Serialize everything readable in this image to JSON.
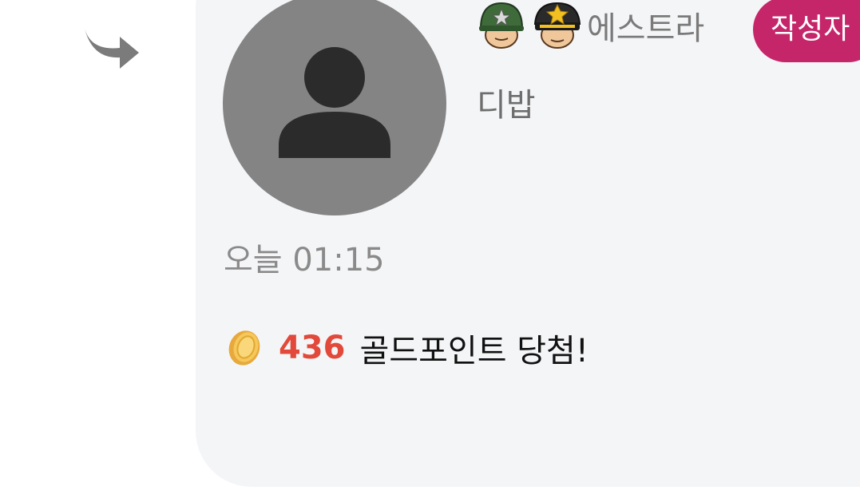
{
  "comment": {
    "nickname": "에스트라",
    "author_badge": "작성자",
    "text": "디밥",
    "timestamp": "오늘 01:15",
    "reward": {
      "points": "436",
      "message": "골드포인트 당첨!"
    },
    "badges": [
      "army-helmet-icon",
      "officer-cap-icon"
    ]
  },
  "colors": {
    "bubble_bg": "#f4f5f7",
    "avatar_bg": "#848484",
    "author_badge_bg": "#c5266a",
    "points_color": "#e2493a",
    "reply_arrow": "#7b7b7b"
  }
}
